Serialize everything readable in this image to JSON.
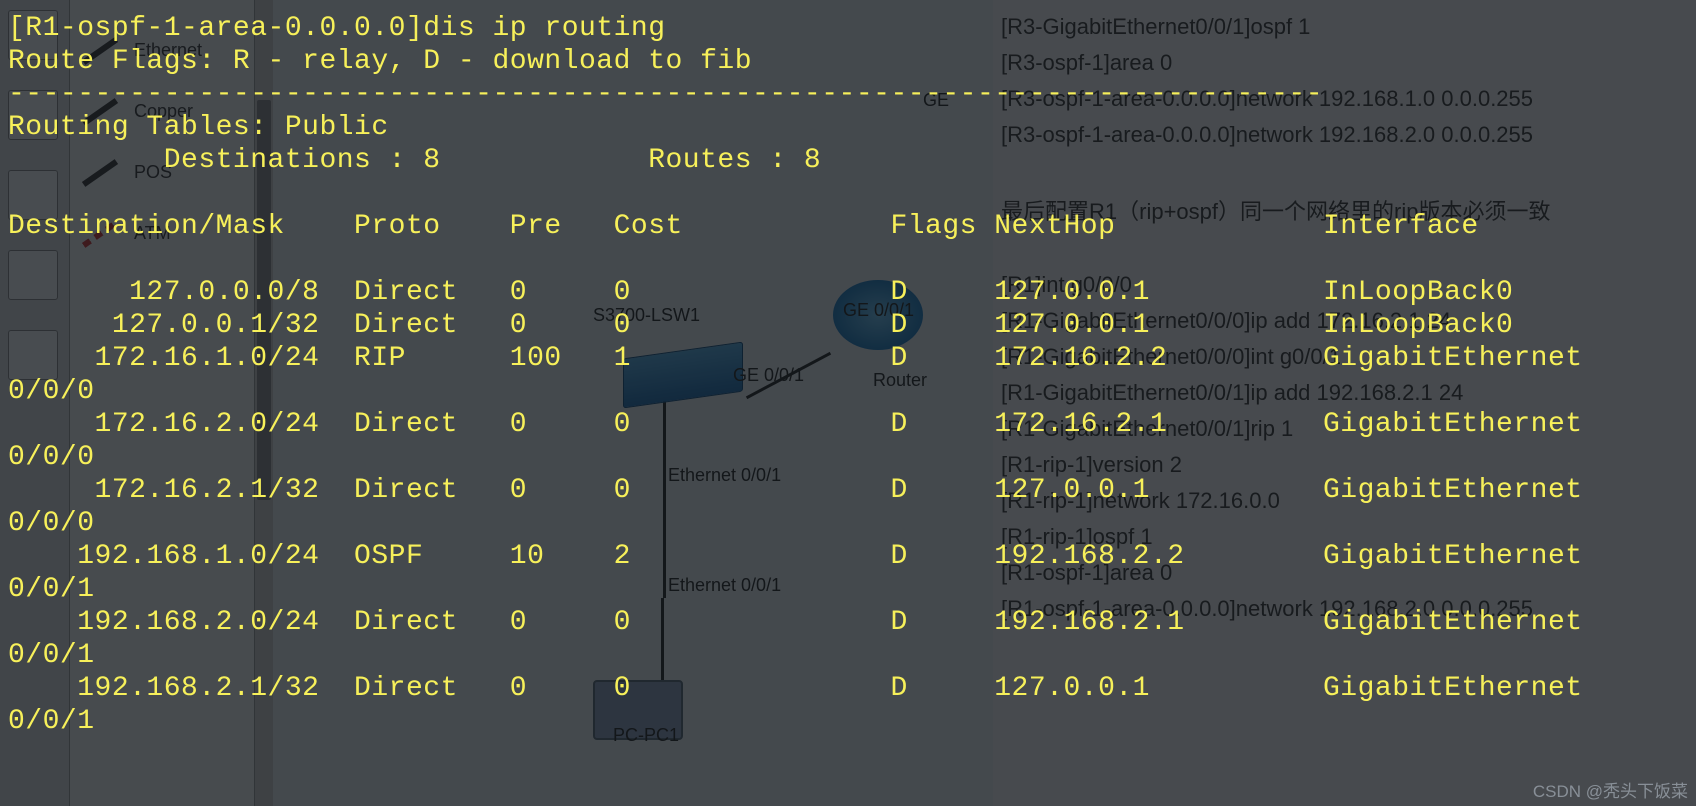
{
  "bg": {
    "palette_items": [
      "Ethernet",
      "Copper",
      "POS",
      "ATM"
    ],
    "switch_label": "S3700-LSW1",
    "link_ge001a": "GE 0/0/1",
    "link_ge001b": "GE 0/0/1",
    "router_label": "Router",
    "eth_001a": "Ethernet 0/0/1",
    "eth_001b": "Ethernet 0/0/1",
    "pc_label": "PC-PC1",
    "right_commands": [
      "[R3-GigabitEthernet0/0/1]ospf 1",
      "[R3-ospf-1]area 0",
      "[R3-ospf-1-area-0.0.0.0]network 192.168.1.0 0.0.0.255",
      "[R3-ospf-1-area-0.0.0.0]network 192.168.2.0 0.0.0.255",
      "",
      "最后配置R1（rip+ospf）同一个网络里的rip版本必须一致",
      "",
      "[R1]int g0/0/0",
      "[R1-GigabitEthernet0/0/0]ip add 172.16.2.1 24",
      "[R1-GigabitEthernet0/0/0]int g0/0/1",
      "[R1-GigabitEthernet0/0/1]ip add 192.168.2.1 24",
      "[R1-GigabitEthernet0/0/1]rip 1",
      "[R1-rip-1]version 2",
      "[R1-rip-1]network 172.16.0.0",
      "[R1-rip-1]ospf 1",
      "[R1-ospf-1]area 0",
      "[R1-ospf-1-area-0.0.0.0]network 192.168.2.0 0.0.0.255"
    ],
    "ge_label": "GE"
  },
  "term": {
    "prompt": "[R1-ospf-1-area-0.0.0.0]dis ip routing",
    "flags_legend": "Route Flags: R - relay, D - download to fib",
    "divider": "----------------------------------------------------------------------------",
    "tables_header": "Routing Tables: Public",
    "summary_dest_label": "Destinations :",
    "summary_dest_val": "8",
    "summary_routes_label": "Routes :",
    "summary_routes_val": "8",
    "col": {
      "dest": "Destination/Mask",
      "proto": "Proto",
      "pre": "Pre",
      "cost": "Cost",
      "flags": "Flags",
      "nexthop": "NextHop",
      "iface": "Interface"
    },
    "rows": [
      {
        "dest": "127.0.0.0/8",
        "proto": "Direct",
        "pre": "0",
        "cost": "0",
        "flags": "D",
        "nh": "127.0.0.1",
        "iface": "InLoopBack0",
        "wrap": ""
      },
      {
        "dest": "127.0.0.1/32",
        "proto": "Direct",
        "pre": "0",
        "cost": "0",
        "flags": "D",
        "nh": "127.0.0.1",
        "iface": "InLoopBack0",
        "wrap": ""
      },
      {
        "dest": "172.16.1.0/24",
        "proto": "RIP",
        "pre": "100",
        "cost": "1",
        "flags": "D",
        "nh": "172.16.2.2",
        "iface": "GigabitEthernet",
        "wrap": "0/0/0"
      },
      {
        "dest": "172.16.2.0/24",
        "proto": "Direct",
        "pre": "0",
        "cost": "0",
        "flags": "D",
        "nh": "172.16.2.1",
        "iface": "GigabitEthernet",
        "wrap": "0/0/0"
      },
      {
        "dest": "172.16.2.1/32",
        "proto": "Direct",
        "pre": "0",
        "cost": "0",
        "flags": "D",
        "nh": "127.0.0.1",
        "iface": "GigabitEthernet",
        "wrap": "0/0/0"
      },
      {
        "dest": "192.168.1.0/24",
        "proto": "OSPF",
        "pre": "10",
        "cost": "2",
        "flags": "D",
        "nh": "192.168.2.2",
        "iface": "GigabitEthernet",
        "wrap": "0/0/1"
      },
      {
        "dest": "192.168.2.0/24",
        "proto": "Direct",
        "pre": "0",
        "cost": "0",
        "flags": "D",
        "nh": "192.168.2.1",
        "iface": "GigabitEthernet",
        "wrap": "0/0/1"
      },
      {
        "dest": "192.168.2.1/32",
        "proto": "Direct",
        "pre": "0",
        "cost": "0",
        "flags": "D",
        "nh": "127.0.0.1",
        "iface": "GigabitEthernet",
        "wrap": "0/0/1"
      }
    ]
  },
  "watermark": "CSDN @秃头下饭菜"
}
